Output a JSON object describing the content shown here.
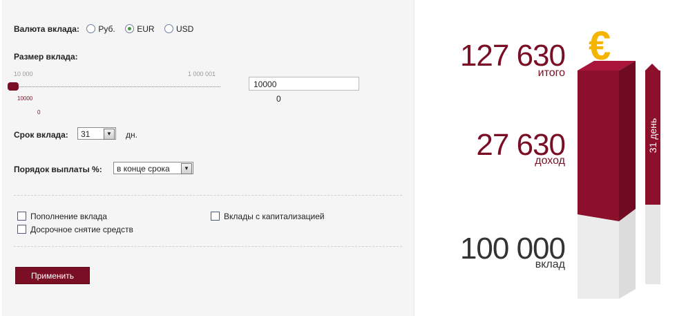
{
  "currency": {
    "label": "Валюта вклада:",
    "options": [
      {
        "label": "Руб.",
        "selected": false
      },
      {
        "label": "EUR",
        "selected": true
      },
      {
        "label": "USD",
        "selected": false
      }
    ]
  },
  "amount": {
    "label": "Размер вклада:",
    "slider_min_label": "10 000",
    "slider_max_label": "1 000 001",
    "slider_value_label": "10000",
    "slider_secondary_label": "0",
    "slider_fraction": 0.0,
    "input_value": "10000",
    "under_input_value": "0"
  },
  "term": {
    "label": "Срок вклада:",
    "value": "31",
    "unit": "дн."
  },
  "payout": {
    "label": "Порядок выплаты %:",
    "value": "в конце срока"
  },
  "checkboxes": {
    "topup": "Пополнение вклада",
    "early": "Досрочное снятие средств",
    "capitalization": "Вклады с капитализацией"
  },
  "apply_button": "Применить",
  "summary": {
    "total_value": "127 630",
    "total_label": "итого",
    "income_value": "27 630",
    "income_label": "доход",
    "deposit_value": "100 000",
    "deposit_label": "вклад",
    "currency_symbol": "€",
    "term_label": "31 день"
  },
  "colors": {
    "accent": "#7a0e25",
    "euro": "#f4b400",
    "gray_text": "#333333"
  }
}
